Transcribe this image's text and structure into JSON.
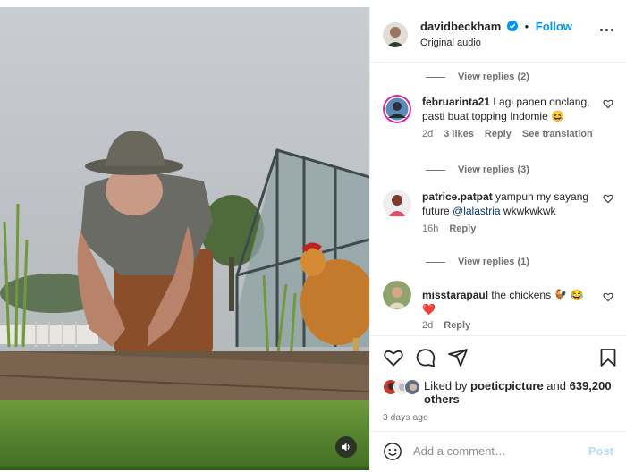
{
  "header": {
    "username": "davidbeckham",
    "follow_label": "Follow",
    "separator": "•",
    "audio": "Original audio"
  },
  "comments": {
    "view_replies": [
      "View replies (2)",
      "View replies (3)",
      "View replies (1)"
    ],
    "items": [
      {
        "user": "februarinta21",
        "text": "Lagi panen onclang, pasti buat topping Indomie 😆",
        "time": "2d",
        "likes": "3 likes",
        "reply": "Reply",
        "translate": "See translation"
      },
      {
        "user": "patrice.patpat",
        "text_before": "yampun my sayang future ",
        "mention": "@lalastria",
        "text_after": " wkwkwkwk",
        "time": "16h",
        "reply": "Reply"
      },
      {
        "user": "misstarapaul",
        "text": "the chickens 🐓 😂❤️",
        "time": "2d",
        "reply": "Reply"
      }
    ]
  },
  "actions": {
    "icons": [
      "heart-icon",
      "comment-icon",
      "share-icon",
      "bookmark-icon"
    ]
  },
  "likes": {
    "prefix": "Liked by ",
    "user": "poeticpicture",
    "middle": " and ",
    "count": "639,200 others"
  },
  "timestamp": "3 days ago",
  "composer": {
    "placeholder": "Add a comment…",
    "post_label": "Post"
  },
  "colors": {
    "accent": "#0095f6",
    "muted": "#737373",
    "post_disabled": "#b3dbff"
  }
}
